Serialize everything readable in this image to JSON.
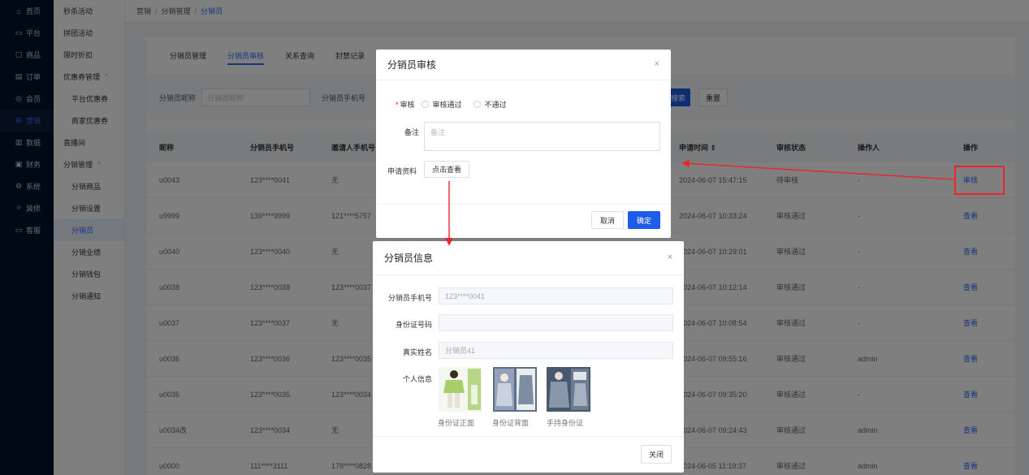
{
  "nav1": [
    {
      "label": "首页",
      "icon": "home-icon",
      "glyph": "⌂"
    },
    {
      "label": "平台",
      "icon": "monitor-icon",
      "glyph": "▭"
    },
    {
      "label": "商品",
      "icon": "box-icon",
      "glyph": "▢"
    },
    {
      "label": "订单",
      "icon": "document-icon",
      "glyph": "▤"
    },
    {
      "label": "会员",
      "icon": "member-icon",
      "glyph": "◎"
    },
    {
      "label": "营销",
      "icon": "gift-icon",
      "glyph": "⊞"
    },
    {
      "label": "数据",
      "icon": "chart-icon",
      "glyph": "▥"
    },
    {
      "label": "财务",
      "icon": "finance-icon",
      "glyph": "▣"
    },
    {
      "label": "系统",
      "icon": "settings-icon",
      "glyph": "⚙"
    },
    {
      "label": "装修",
      "icon": "decorate-icon",
      "glyph": "✧"
    },
    {
      "label": "客服",
      "icon": "service-icon",
      "glyph": "▭"
    }
  ],
  "nav2": [
    {
      "label": "秒杀活动"
    },
    {
      "label": "拼团活动"
    },
    {
      "label": "限时折扣"
    },
    {
      "label": "优惠券管理",
      "arrow": "^"
    },
    {
      "label": "平台优惠券",
      "sub": true
    },
    {
      "label": "商家优惠券",
      "sub": true
    },
    {
      "label": "直播间"
    },
    {
      "label": "分销管理",
      "arrow": "^"
    },
    {
      "label": "分销商品",
      "sub": true
    },
    {
      "label": "分销设置",
      "sub": true
    },
    {
      "label": "分销员",
      "sub": true
    },
    {
      "label": "分销业绩",
      "sub": true
    },
    {
      "label": "分销钱包",
      "sub": true
    },
    {
      "label": "分销通知",
      "sub": true
    }
  ],
  "breadcrumb": {
    "a": "营销",
    "b": "分销管理",
    "c": "分销员",
    "sep": "/"
  },
  "tabs": [
    "分销员管理",
    "分销员审核",
    "关系查询",
    "封禁记录"
  ],
  "filter": {
    "nickname_label": "分销员昵称",
    "nickname_placeholder": "分销员昵称",
    "phone_label": "分销员手机号",
    "search": "搜索",
    "reset": "重置"
  },
  "table": {
    "headers": [
      "昵称",
      "分销员手机号",
      "邀请人手机号",
      "",
      "申请时间 ⇕",
      "审核状态",
      "操作人",
      "操作"
    ],
    "rows": [
      [
        "u0043",
        "123****0041",
        "无",
        "2024-06-07 15:47:15",
        "待审核",
        "-",
        "审核"
      ],
      [
        "u9999",
        "139****9999",
        "121****5757",
        "2024-06-07 10:33:24",
        "审核通过",
        "-",
        "查看"
      ],
      [
        "u0040",
        "123****0040",
        "无",
        "2024-06-07 10:29:01",
        "审核通过",
        "-",
        "查看"
      ],
      [
        "u0038",
        "123****0038",
        "123****0037",
        "2024-06-07 10:12:14",
        "审核通过",
        "-",
        "查看"
      ],
      [
        "u0037",
        "123****0037",
        "无",
        "2024-06-07 10:08:54",
        "审核通过",
        "-",
        "查看"
      ],
      [
        "u0036",
        "123****0036",
        "123****0035",
        "2024-06-07 09:55:16",
        "审核通过",
        "admin",
        "查看"
      ],
      [
        "u0035",
        "123****0035",
        "123****0034",
        "2024-06-07 09:35:20",
        "审核通过",
        "-",
        "查看"
      ],
      [
        "u0034改",
        "123****0034",
        "无",
        "2024-06-07 09:24:43",
        "审核通过",
        "admin",
        "查看"
      ],
      [
        "u0000",
        "111****3111",
        "178****0828",
        "2024-06-05 11:19:37",
        "审核通过",
        "admin",
        "查看"
      ]
    ]
  },
  "audit_dialog": {
    "title": "分销员审核",
    "close": "×",
    "audit_label": "审核",
    "required": "*",
    "opt_pass": "审核通过",
    "opt_fail": "不通过",
    "remark_label": "备注",
    "remark_placeholder": "备注",
    "material_label": "申请资料",
    "view_button": "点击查看",
    "cancel": "取消",
    "confirm": "确定"
  },
  "info_dialog": {
    "title": "分销员信息",
    "close": "×",
    "phone_label": "分销员手机号",
    "phone_value": "123****0041",
    "id_label": "身份证号码",
    "id_value": "",
    "name_label": "真实姓名",
    "name_value": "分销员41",
    "personal_label": "个人信息",
    "captions": [
      "身份证正面",
      "身份证背面",
      "手持身份证"
    ],
    "close_button": "关闭"
  },
  "colors": {
    "accent": "#1d5ce8",
    "annotation": "#e8262d",
    "sidebar": "#001529"
  }
}
